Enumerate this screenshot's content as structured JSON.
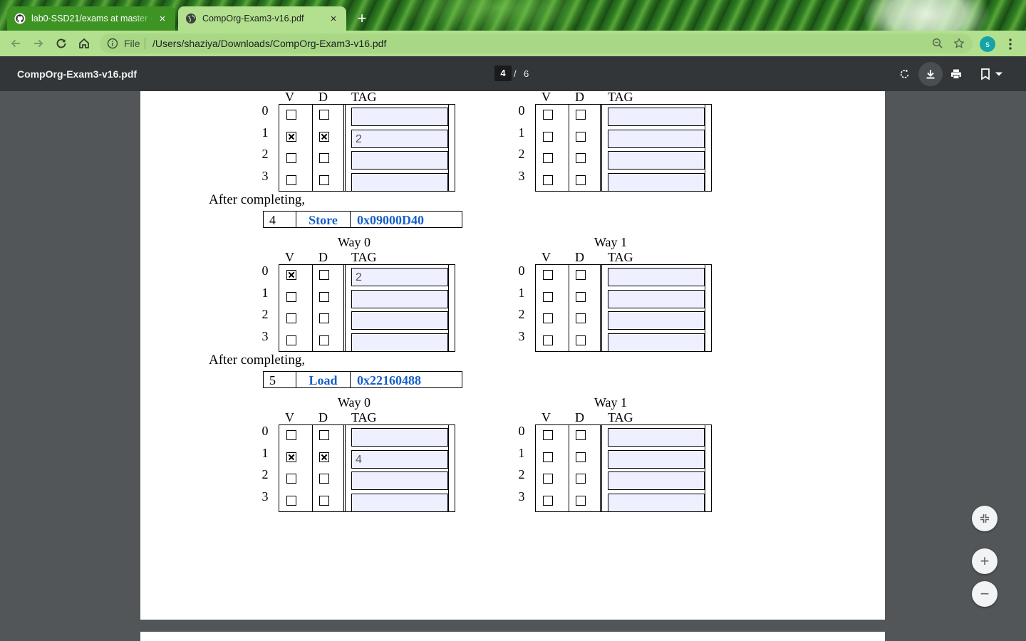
{
  "tabs": [
    {
      "title": "lab0-SSD21/exams at master · ",
      "close": "×",
      "favicon": "github-icon",
      "active": false
    },
    {
      "title": "CompOrg-Exam3-v16.pdf",
      "close": "×",
      "favicon": "globe-icon",
      "active": true
    }
  ],
  "new_tab_label": "+",
  "toolbar": {
    "scheme": "File",
    "url": "/Users/shaziya/Downloads/CompOrg-Exam3-v16.pdf",
    "avatar": "s"
  },
  "pdf_toolbar": {
    "title": "CompOrg-Exam3-v16.pdf",
    "page_current": "4",
    "page_sep": "/",
    "page_total": "6"
  },
  "labels": {
    "way0": "Way 0",
    "way1": "Way 1",
    "v": "V",
    "d": "D",
    "tag": "TAG",
    "after": "After completing,",
    "rows": [
      "0",
      "1",
      "2",
      "3"
    ]
  },
  "sections": [
    {
      "way0": [
        {
          "v": false,
          "d": false,
          "tag": ""
        },
        {
          "v": true,
          "d": true,
          "tag": "2"
        },
        {
          "v": false,
          "d": false,
          "tag": ""
        },
        {
          "v": false,
          "d": false,
          "tag": ""
        }
      ],
      "way1": [
        {
          "v": false,
          "d": false,
          "tag": ""
        },
        {
          "v": false,
          "d": false,
          "tag": ""
        },
        {
          "v": false,
          "d": false,
          "tag": ""
        },
        {
          "v": false,
          "d": false,
          "tag": ""
        }
      ]
    },
    {
      "op": {
        "num": "4",
        "type": "Store",
        "addr": "0x09000D40"
      },
      "way0": [
        {
          "v": true,
          "d": false,
          "tag": "2"
        },
        {
          "v": false,
          "d": false,
          "tag": ""
        },
        {
          "v": false,
          "d": false,
          "tag": ""
        },
        {
          "v": false,
          "d": false,
          "tag": ""
        }
      ],
      "way1": [
        {
          "v": false,
          "d": false,
          "tag": ""
        },
        {
          "v": false,
          "d": false,
          "tag": ""
        },
        {
          "v": false,
          "d": false,
          "tag": ""
        },
        {
          "v": false,
          "d": false,
          "tag": ""
        }
      ]
    },
    {
      "op": {
        "num": "5",
        "type": "Load",
        "addr": "0x22160488"
      },
      "way0": [
        {
          "v": false,
          "d": false,
          "tag": ""
        },
        {
          "v": true,
          "d": true,
          "tag": "4"
        },
        {
          "v": false,
          "d": false,
          "tag": ""
        },
        {
          "v": false,
          "d": false,
          "tag": ""
        }
      ],
      "way1": [
        {
          "v": false,
          "d": false,
          "tag": ""
        },
        {
          "v": false,
          "d": false,
          "tag": ""
        },
        {
          "v": false,
          "d": false,
          "tag": ""
        },
        {
          "v": false,
          "d": false,
          "tag": ""
        }
      ]
    }
  ],
  "zoom_controls": {
    "fit": "fit-to-page-icon",
    "zoom_in": "+",
    "zoom_out": "−"
  }
}
